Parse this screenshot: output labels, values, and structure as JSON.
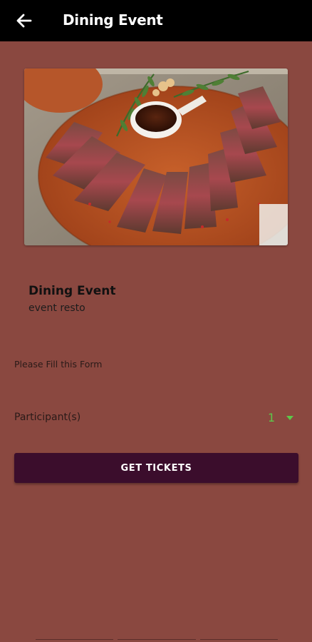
{
  "header": {
    "title": "Dining Event",
    "back_icon": "arrow-left-icon"
  },
  "hero": {
    "image_description": "sliced-steak-on-wooden-board"
  },
  "event": {
    "title": "Dining Event",
    "subtitle": "event resto"
  },
  "form": {
    "instruction": "Please Fill this Form",
    "participants_label": "Participant(s)",
    "participants_value": "1"
  },
  "actions": {
    "get_tickets_label": "GET TICKETS"
  },
  "colors": {
    "background": "#8a4840",
    "appbar": "#000000",
    "button": "#3b0d2c",
    "accent_green": "#5cc84a"
  }
}
